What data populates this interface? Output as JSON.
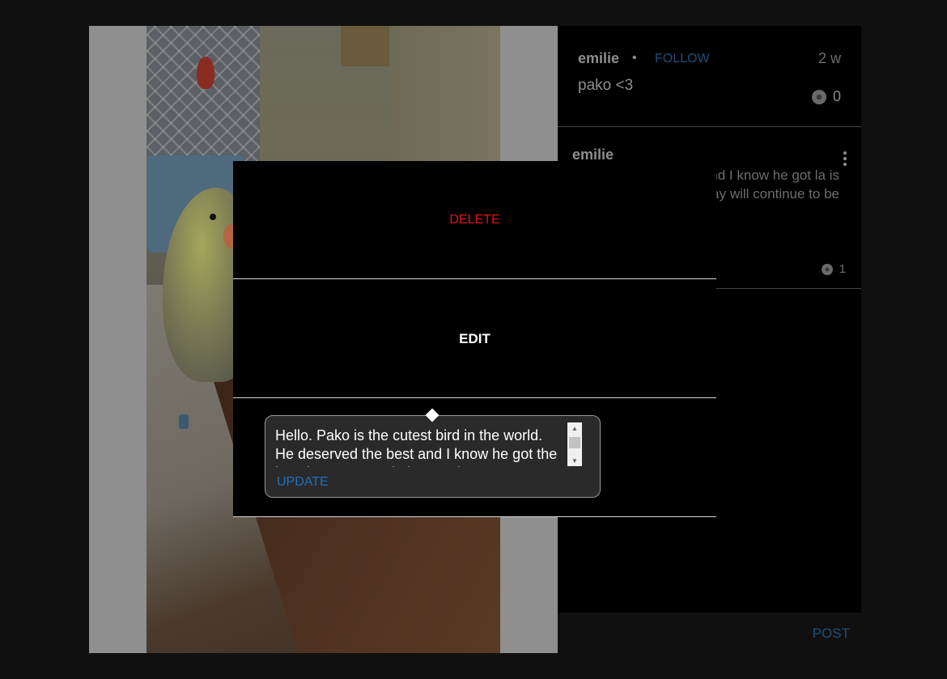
{
  "post": {
    "author": "emilie",
    "separator": "•",
    "follow_label": "FOLLOW",
    "time_ago": "2 w",
    "caption": "pako <3",
    "likes": "0"
  },
  "comment": {
    "author": "emilie",
    "text": "t bird in the world. nd I know he got la is amazing. May will continue to be",
    "likes": "1"
  },
  "post_button_label": "POST",
  "options": {
    "delete_label": "DELETE",
    "edit_label": "EDIT"
  },
  "edit_box": {
    "value": "Hello. Pako is the cutest bird in the world. He deserved the best and I know he got the best because Paola is amazing.",
    "update_label": "UPDATE"
  },
  "colors": {
    "delete": "#e0141b",
    "link": "#1f6fbd",
    "modal_bg": "#000000"
  },
  "icons": {
    "like": "paw-icon",
    "more": "kebab-icon"
  }
}
